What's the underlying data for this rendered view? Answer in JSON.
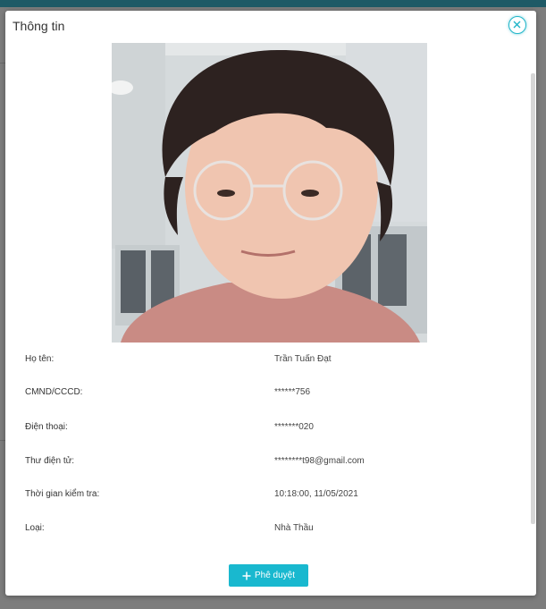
{
  "modal": {
    "title": "Thông tin"
  },
  "fields": [
    {
      "label": "Họ tên:",
      "value": "Trần Tuấn Đạt"
    },
    {
      "label": "CMND/CCCD:",
      "value": "******756"
    },
    {
      "label": "Điện thoại:",
      "value": "*******020"
    },
    {
      "label": "Thư điện tử:",
      "value": "********t98@gmail.com"
    },
    {
      "label": "Thời gian kiểm tra:",
      "value": "10:18:00, 11/05/2021"
    },
    {
      "label": "Loại:",
      "value": "Nhà Thầu"
    }
  ],
  "actions": {
    "approve_label": "Phê duyệt"
  },
  "icons": {
    "close": "close-icon",
    "plus": "plus-icon"
  },
  "colors": {
    "accent": "#19b8cf",
    "topbar": "#1e5a66",
    "overlay": "#7d7d7d"
  }
}
